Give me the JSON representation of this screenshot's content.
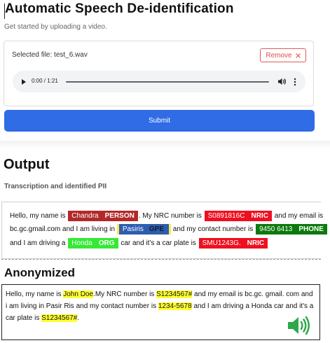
{
  "header": {
    "title": "Automatic Speech De-identification",
    "subtitle": "Get started by uploading a video."
  },
  "upload": {
    "selected_file": "Selected file: test_6.wav",
    "remove_label": "Remove",
    "remove_icon": "x-icon"
  },
  "audio": {
    "time": "0:00 / 1:21",
    "progress": 0.0
  },
  "submit_label": "Submit",
  "output": {
    "heading": "Output",
    "pii_label": "Transcription and identified PII",
    "line1": {
      "t1": "Hello, my name is",
      "person_text": "Chandra",
      "person_tag": "PERSON",
      "t2": ". My NRC number is",
      "nric_text": "S0891816C",
      "nric_tag": "NRIC",
      "t3": "and my email is"
    },
    "line2": {
      "t1": "bc.gc.gmail.com and I am living in",
      "gpe_text": "Pasiris",
      "gpe_tag": "GPE",
      "t2": "and my contact number is",
      "phone_text": "9450 6413",
      "phone_tag": "PHONE"
    },
    "line3": {
      "t1": "and I am driving a",
      "org_text": "Honda",
      "org_tag": "ORG",
      "t2": "car and it's a car plate is",
      "nric_text": "SMU1243G.",
      "nric_tag": "NRIC"
    }
  },
  "anonymized": {
    "heading": "Anonymized",
    "line1": {
      "t1": "Hello, my name is",
      "m1": "John Doe",
      "t2": ".My NRC  number is",
      "m2": "S1234567#",
      "t3": "and my email is bc.gc. gmail. com and"
    },
    "line2": {
      "t1": "i am living in Pasir Ris  and my contact number is",
      "m1": "1234-5678",
      "t2": "and I am driving a Honda car and it's a"
    },
    "line3": {
      "t1": "car plate is",
      "m1": "S1234567#",
      "t2": "."
    },
    "speaker_icon": "speaker-icon"
  },
  "colors": {
    "primary": "#2f6ce5",
    "person": "#b22929",
    "nric": "#ee1020",
    "gpe": "#2c5db0",
    "phone": "#0c7a0c",
    "org": "#35e935",
    "mask": "#ffff33",
    "speaker": "#2fa84a"
  }
}
